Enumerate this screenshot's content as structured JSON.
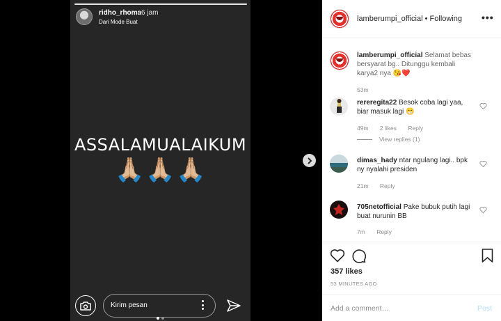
{
  "story": {
    "username": "ridho_rhoma",
    "time": "6 jam",
    "subtitle": "Dari Mode Buat",
    "text": "ASSALAMUALAIKUM",
    "emojis": [
      "🙏🏼",
      "🙏🏼",
      "🙏🏼"
    ],
    "message_placeholder": "Kirim pesan",
    "dot_colors": [
      "#ffffff",
      "#8e8e8e"
    ]
  },
  "post": {
    "username": "lamberumpi_official",
    "separator": " • ",
    "follow_status": "Following",
    "more_glyph": "•••",
    "caption": {
      "user": "lamberumpi_official",
      "text": "Selamat bebas bersyarat bg.. Ditunggu kembali karya2 nya 😘❤️",
      "time": "53m"
    },
    "comments": [
      {
        "user": "rereregita22",
        "text": "Besok coba lagi yaa, biar masuk lagi 😁",
        "time": "49m",
        "likes": "2 likes",
        "reply": "Reply",
        "view_replies": "View replies (1)"
      },
      {
        "user": "dimas_hady",
        "text": "ntar ngulang lagi.. bpk ny nyalahi presiden",
        "time": "21m",
        "reply": "Reply"
      },
      {
        "user": "705netofficial",
        "text": "Pake bubuk putih lagi buat nurunin BB",
        "time": "7m",
        "reply": "Reply"
      }
    ],
    "likes_count": "357 likes",
    "posted_time": "53 MINUTES AGO",
    "add_comment_placeholder": "Add a comment…",
    "post_label": "Post"
  },
  "colors": {
    "accent_disabled": "#b2dffc",
    "muted": "#8e8e8e",
    "text": "#262626",
    "story_bg": "#262626"
  }
}
